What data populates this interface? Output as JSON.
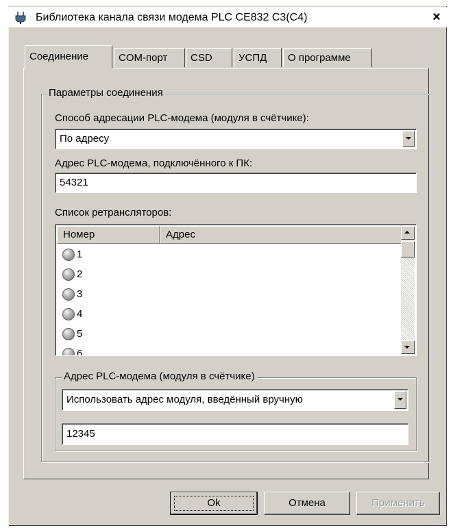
{
  "window": {
    "title": "Библиотека канала связи модема PLC CE832 C3(C4)",
    "close_label": "×"
  },
  "tabs": [
    {
      "label": "Соединение",
      "active": true
    },
    {
      "label": "COM-порт",
      "active": false
    },
    {
      "label": "CSD",
      "active": false
    },
    {
      "label": "УСПД",
      "active": false
    },
    {
      "label": "О программе",
      "active": false
    }
  ],
  "connection": {
    "group_title": "Параметры соединения",
    "addressing_label": "Способ адресации PLC-модема (модуля в счётчике):",
    "addressing_value": "По адресу",
    "pc_modem_label": "Адрес PLC-модема, подключённого к ПК:",
    "pc_modem_value": "54321",
    "repeaters_label": "Список ретрансляторов:",
    "repeaters_columns": [
      "Номер",
      "Адрес"
    ],
    "repeaters": [
      "1",
      "2",
      "3",
      "4",
      "5",
      "6"
    ]
  },
  "module": {
    "group_title": "Адрес PLC-модема (модуля в счётчике)",
    "mode_value": "Использовать адрес модуля, введённый вручную",
    "address_value": "12345"
  },
  "buttons": {
    "ok": "Ok",
    "cancel": "Отмена",
    "apply": "Применить"
  },
  "icons": {
    "title_icon": "plug-icon",
    "status_icon": "gray-led-icon"
  }
}
